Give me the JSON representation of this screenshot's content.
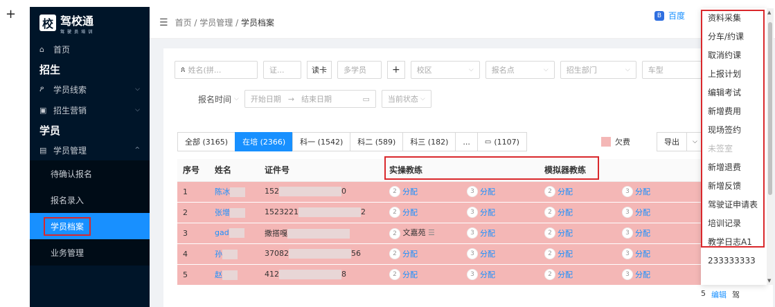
{
  "plus_symbol": "+",
  "sidebar": {
    "logo_char": "校",
    "logo_name": "驾校通",
    "logo_sub": "驾 驶 员 培 训",
    "items": [
      {
        "label": "首页",
        "icon": "home-icon",
        "glyph": "⌂"
      }
    ],
    "section_recruit": "招生",
    "recruit_items": [
      {
        "label": "学员线索",
        "icon": "user-lead-icon",
        "glyph": "ዖ"
      },
      {
        "label": "招生营销",
        "icon": "marketing-icon",
        "glyph": "▣"
      }
    ],
    "section_student": "学员",
    "student_mgmt": {
      "label": "学员管理",
      "icon": "student-mgmt-icon",
      "glyph": "▤"
    },
    "sub_items": [
      "待确认报名",
      "报名录入",
      "学员档案",
      "业务管理"
    ]
  },
  "topbar": {
    "breadcrumb": [
      "首页",
      "学员管理",
      "学员档案"
    ],
    "separator": "/",
    "baidu_label": "百度",
    "baidu_icon_char": "B"
  },
  "filters": {
    "name_placeholder": "姓名(拼...",
    "cert_placeholder": "证...",
    "read_card": "读卡",
    "multi_student": "多学员",
    "add": "+",
    "campus": "校区",
    "signup_point": "报名点",
    "recruit_dept": "招生部门",
    "car_type": "车型",
    "signup_time": "报名时间",
    "start_date": "开始日期",
    "arrow": "→",
    "end_date": "结束日期",
    "current_status": "当前状态"
  },
  "tabs": [
    {
      "label": "全部 (3165)"
    },
    {
      "label": "在培 (2366)"
    },
    {
      "label": "科一 (1542)"
    },
    {
      "label": "科二 (589)"
    },
    {
      "label": "科三 (182)"
    },
    {
      "label": "..."
    },
    {
      "label": "(1107)"
    }
  ],
  "arrears_label": "欠费",
  "export_label": "导出",
  "table": {
    "headers": [
      "序号",
      "姓名",
      "证件号",
      "实操教练",
      "",
      "模拟器教练",
      ""
    ],
    "assign_label": "分配",
    "rows": [
      {
        "idx": "1",
        "name": "陈冰",
        "id_prefix": "152",
        "id_suffix": "0"
      },
      {
        "idx": "2",
        "name": "张增",
        "id_prefix": "1523221",
        "id_suffix": "2"
      },
      {
        "idx": "3",
        "name": "gad",
        "id_prefix": "撒搭嘎",
        "id_suffix": "",
        "coach": "文嘉苑"
      },
      {
        "idx": "4",
        "name": "孙",
        "id_prefix": "37082",
        "id_suffix": "56"
      },
      {
        "idx": "5",
        "name": "赵",
        "id_prefix": "412",
        "id_suffix": "8"
      }
    ],
    "circle_a": "2",
    "circle_b": "3"
  },
  "dropdown_menu": {
    "items": [
      "资料采集",
      "分车/约课",
      "取消约课",
      "上报计划",
      "编辑考试",
      "新增费用",
      "现场签约",
      "未签室",
      "新增退费",
      "新增反馈",
      "驾驶证申请表",
      "培训记录",
      "教学日志A1",
      "233333333"
    ],
    "disabled_index": 7
  },
  "row_tail": {
    "prefix": "5",
    "edit": "编辑",
    "more": "驾"
  },
  "colors": {
    "sidebar_bg": "#001529",
    "accent": "#1890ff",
    "arrears_row": "#f4b7b6",
    "highlight": "#d9272b"
  }
}
